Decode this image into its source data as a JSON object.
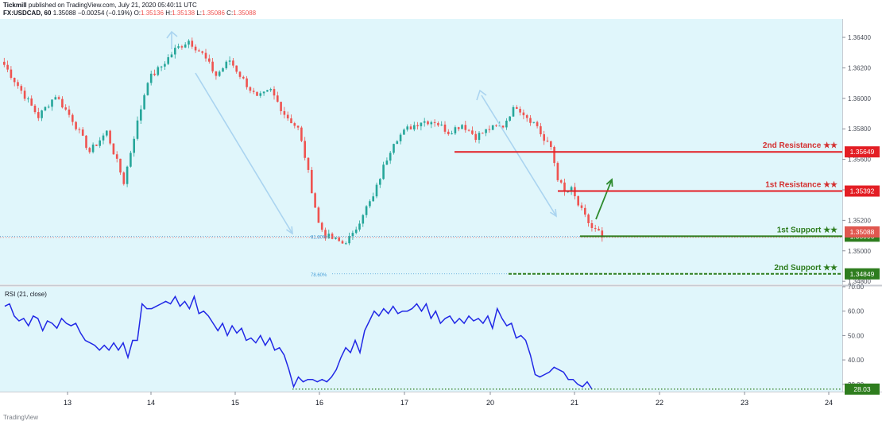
{
  "header": {
    "publisher": "Tickmill",
    "published_text": "published on TradingView.com, July 21, 2020 05:40:11 UTC",
    "symbol": "FX:USDCAD, 60",
    "last": "1.35088",
    "change": "−0.00254 (−0.19%)",
    "o_label": "O:",
    "o_value": "1.35136",
    "h_label": "H:",
    "h_value": "1.35138",
    "l_label": "L:",
    "l_value": "1.35086",
    "c_label": "C:",
    "c_value": "1.35088"
  },
  "footer": {
    "logo_text": "TradingView"
  },
  "colors": {
    "up": "#26a69a",
    "down": "#ef5350",
    "resistance": "#e31e24",
    "support": "#2e7d1e",
    "arrow": "#aad4f0",
    "rsi": "#2128e6",
    "background": "#e0f6fb"
  },
  "chart_data": [
    {
      "type": "candlestick",
      "symbol": "FX:USDCAD",
      "interval": "60",
      "x_tick_labels": [
        "13",
        "14",
        "15",
        "16",
        "17",
        "20",
        "21",
        "22",
        "23",
        "24"
      ],
      "y_tick_labels": [
        "1.36400",
        "1.36200",
        "1.36000",
        "1.35800",
        "1.35600",
        "1.35400",
        "1.35200",
        "1.35000",
        "1.34800"
      ],
      "ylim": [
        1.3478,
        1.3652
      ],
      "close_path": [
        [
          0,
          1.3622
        ],
        [
          5,
          1.3605
        ],
        [
          10,
          1.3588
        ],
        [
          15,
          1.3602
        ],
        [
          20,
          1.3586
        ],
        [
          25,
          1.3565
        ],
        [
          30,
          1.3578
        ],
        [
          35,
          1.3545
        ],
        [
          38,
          1.3575
        ],
        [
          42,
          1.3612
        ],
        [
          46,
          1.3621
        ],
        [
          50,
          1.3632
        ],
        [
          54,
          1.3638
        ],
        [
          58,
          1.3629
        ],
        [
          62,
          1.3615
        ],
        [
          66,
          1.3625
        ],
        [
          70,
          1.3612
        ],
        [
          74,
          1.36
        ],
        [
          78,
          1.3605
        ],
        [
          82,
          1.359
        ],
        [
          86,
          1.358
        ],
        [
          88,
          1.3562
        ],
        [
          90,
          1.354
        ],
        [
          92,
          1.3518
        ],
        [
          94,
          1.351
        ],
        [
          96,
          1.3508
        ],
        [
          99,
          1.3505
        ],
        [
          102,
          1.351
        ],
        [
          105,
          1.3525
        ],
        [
          108,
          1.3535
        ],
        [
          111,
          1.3555
        ],
        [
          114,
          1.3572
        ],
        [
          118,
          1.358
        ],
        [
          122,
          1.3585
        ],
        [
          126,
          1.3585
        ],
        [
          130,
          1.3578
        ],
        [
          134,
          1.3583
        ],
        [
          138,
          1.3575
        ],
        [
          142,
          1.358
        ],
        [
          146,
          1.3582
        ],
        [
          148,
          1.359
        ],
        [
          150,
          1.3595
        ],
        [
          153,
          1.3588
        ],
        [
          156,
          1.3582
        ],
        [
          158,
          1.3572
        ],
        [
          160,
          1.3568
        ],
        [
          162,
          1.3548
        ],
        [
          164,
          1.3538
        ],
        [
          166,
          1.354
        ],
        [
          168,
          1.353
        ],
        [
          170,
          1.3522
        ],
        [
          172,
          1.3515
        ],
        [
          174,
          1.3512
        ],
        [
          175,
          1.35088
        ]
      ],
      "resistance_levels": [
        {
          "label": "2nd Resistance ★★",
          "price_label": "1.35649",
          "value": 1.35649
        },
        {
          "label": "1st Resistance ★★",
          "price_label": "1.35392",
          "value": 1.35392
        }
      ],
      "support_levels": [
        {
          "label": "1st Support ★★",
          "price_label": "1.35096",
          "value": 1.35096
        },
        {
          "label": "2nd Support ★★",
          "price_label": "1.34849",
          "value": 1.34849
        }
      ],
      "current_price_label": "1.35088",
      "current_price": 1.35088,
      "fib_labels": [
        {
          "label": "61.80%",
          "value": 1.35096
        },
        {
          "label": "78.60%",
          "value": 1.34849
        }
      ]
    },
    {
      "type": "line",
      "title": "RSI (21, close)",
      "y_tick_labels": [
        "70.00",
        "60.00",
        "50.00",
        "40.00",
        "30.00"
      ],
      "ylim": [
        27,
        70
      ],
      "current_value_label": "28.03",
      "current_value": 28.03,
      "values": [
        62,
        63,
        58,
        56,
        57,
        54,
        58,
        57,
        52,
        56,
        55,
        53,
        57,
        55,
        54,
        55,
        51,
        48,
        47,
        46,
        44,
        46,
        44,
        47,
        44,
        47,
        41,
        48,
        48,
        63,
        61,
        61,
        62,
        63,
        64,
        63,
        66,
        62,
        64,
        61,
        66,
        59,
        60,
        58,
        55,
        52,
        55,
        50,
        54,
        51,
        53,
        48,
        49,
        47,
        50,
        46,
        49,
        44,
        45,
        42,
        36,
        29,
        33,
        31,
        32,
        32,
        31,
        32,
        31,
        33,
        36,
        41,
        45,
        43,
        48,
        43,
        52,
        56,
        60,
        58,
        61,
        59,
        62,
        59,
        60,
        60,
        61,
        63,
        60,
        63,
        57,
        60,
        55,
        57,
        58,
        55,
        57,
        55,
        58,
        56,
        57,
        55,
        58,
        53,
        61,
        57,
        54,
        55,
        49,
        50,
        48,
        42,
        34,
        33,
        34,
        35,
        37,
        36,
        35,
        32,
        32,
        30,
        29,
        31,
        28
      ]
    }
  ]
}
